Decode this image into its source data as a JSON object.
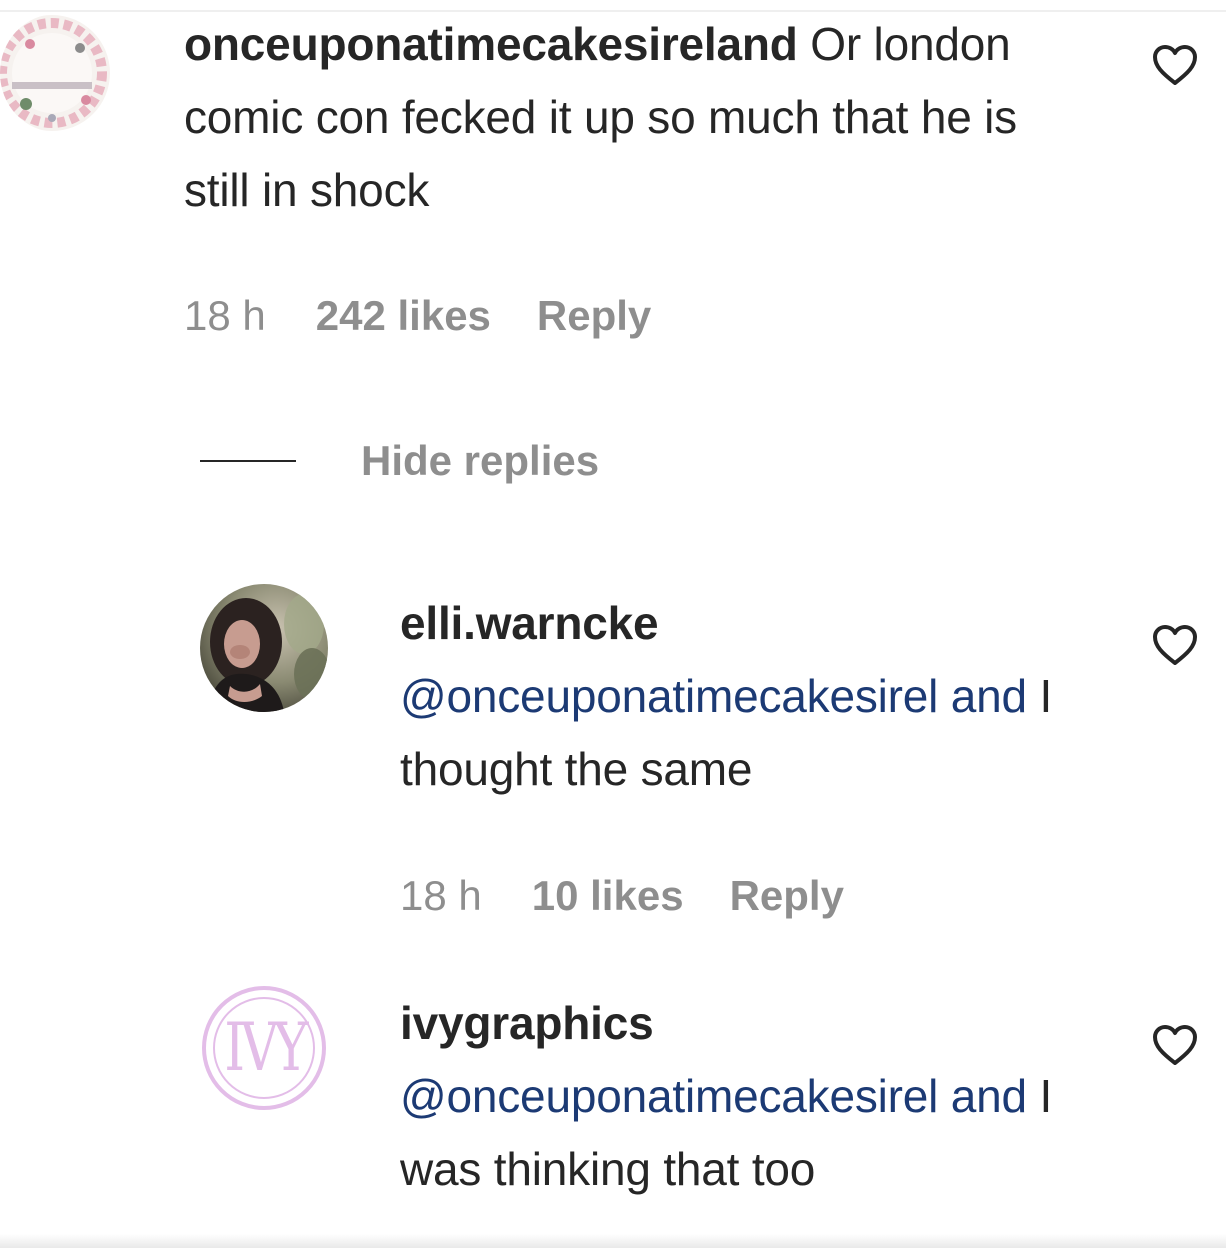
{
  "comments": [
    {
      "username": "onceuponatimecakesireland",
      "text": "Or london comic con fecked it up so much that he is still in shock",
      "time": "18 h",
      "likes": "242 likes",
      "reply_label": "Reply",
      "avatar_icon": "cake-logo-avatar"
    },
    {
      "username": "elli.warncke",
      "mention": "@onceuponatimecakesirel and",
      "text": "I thought the same",
      "time": "18 h",
      "likes": "10 likes",
      "reply_label": "Reply",
      "avatar_icon": "profile-photo-avatar"
    },
    {
      "username": "ivygraphics",
      "mention": "@onceuponatimecakesirel and",
      "text": "I was thinking that too",
      "avatar_icon": "ivy-monogram-avatar",
      "avatar_text": "IVY"
    }
  ],
  "hide_replies_label": "Hide replies",
  "colors": {
    "text": "#262626",
    "meta": "#8e8e8e",
    "mention": "#1c3a74"
  }
}
